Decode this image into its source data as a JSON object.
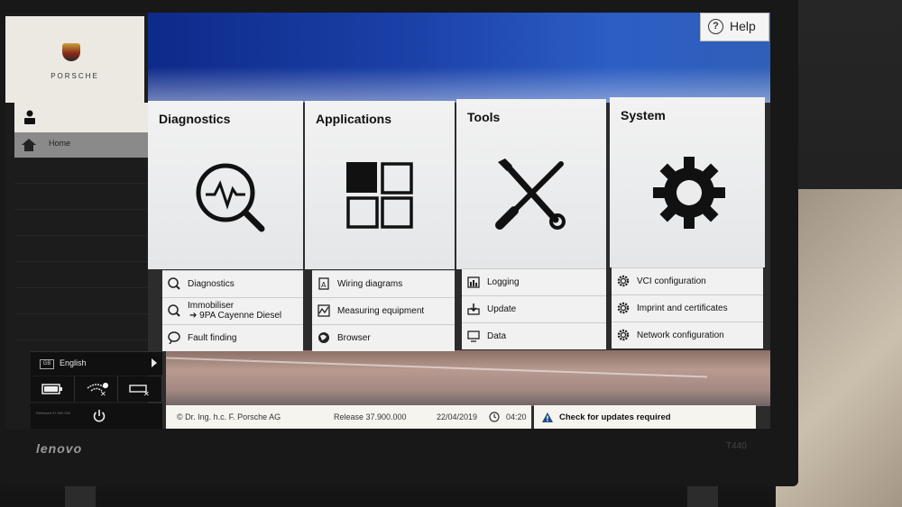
{
  "sidebar": {
    "brand": "PORSCHE",
    "home_label": "Home",
    "language": "English",
    "language_flag": "GB",
    "status_icons": [
      "battery-icon",
      "wifi-disconnected-icon",
      "vci-disconnected-icon"
    ],
    "footer_tiny": "Released 37.900.000"
  },
  "header": {
    "help_label": "Help"
  },
  "tiles": [
    {
      "title": "Diagnostics",
      "icon": "diagnostics-magnifier-icon",
      "items": [
        {
          "label": "Diagnostics",
          "icon": "diagnostics-small-icon"
        },
        {
          "label": "Immobiliser",
          "label2": "➔ 9PA Cayenne Diesel",
          "icon": "immobiliser-icon"
        },
        {
          "label": "Fault finding",
          "icon": "fault-finding-icon"
        }
      ]
    },
    {
      "title": "Applications",
      "icon": "applications-grid-icon",
      "items": [
        {
          "label": "Wiring diagrams",
          "icon": "wiring-diagram-icon"
        },
        {
          "label": "Measuring equipment",
          "icon": "measuring-icon"
        },
        {
          "label": "Browser",
          "icon": "globe-icon"
        }
      ]
    },
    {
      "title": "Tools",
      "icon": "wrench-screwdriver-icon",
      "items": [
        {
          "label": "Logging",
          "icon": "logging-icon"
        },
        {
          "label": "Update",
          "icon": "update-icon"
        },
        {
          "label": "Data",
          "icon": "monitor-icon"
        }
      ]
    },
    {
      "title": "System",
      "icon": "gear-icon",
      "items": [
        {
          "label": "VCI configuration",
          "icon": "gear-small-icon"
        },
        {
          "label": "Imprint and certificates",
          "icon": "gear-small-icon"
        },
        {
          "label": "Network configuration",
          "icon": "gear-small-icon"
        }
      ]
    }
  ],
  "footer": {
    "copyright": "© Dr. Ing. h.c. F. Porsche AG",
    "release": "Release 37.900.000",
    "date": "22/04/2019",
    "time": "04:20",
    "update_notice": "Check for updates required"
  },
  "device": {
    "brand": "lenovo",
    "model": "T440"
  },
  "colors": {
    "header_blue": "#1a3fa6",
    "tile_bg": "#f2f2f2",
    "sidebar_bg": "#1c1c1c"
  }
}
